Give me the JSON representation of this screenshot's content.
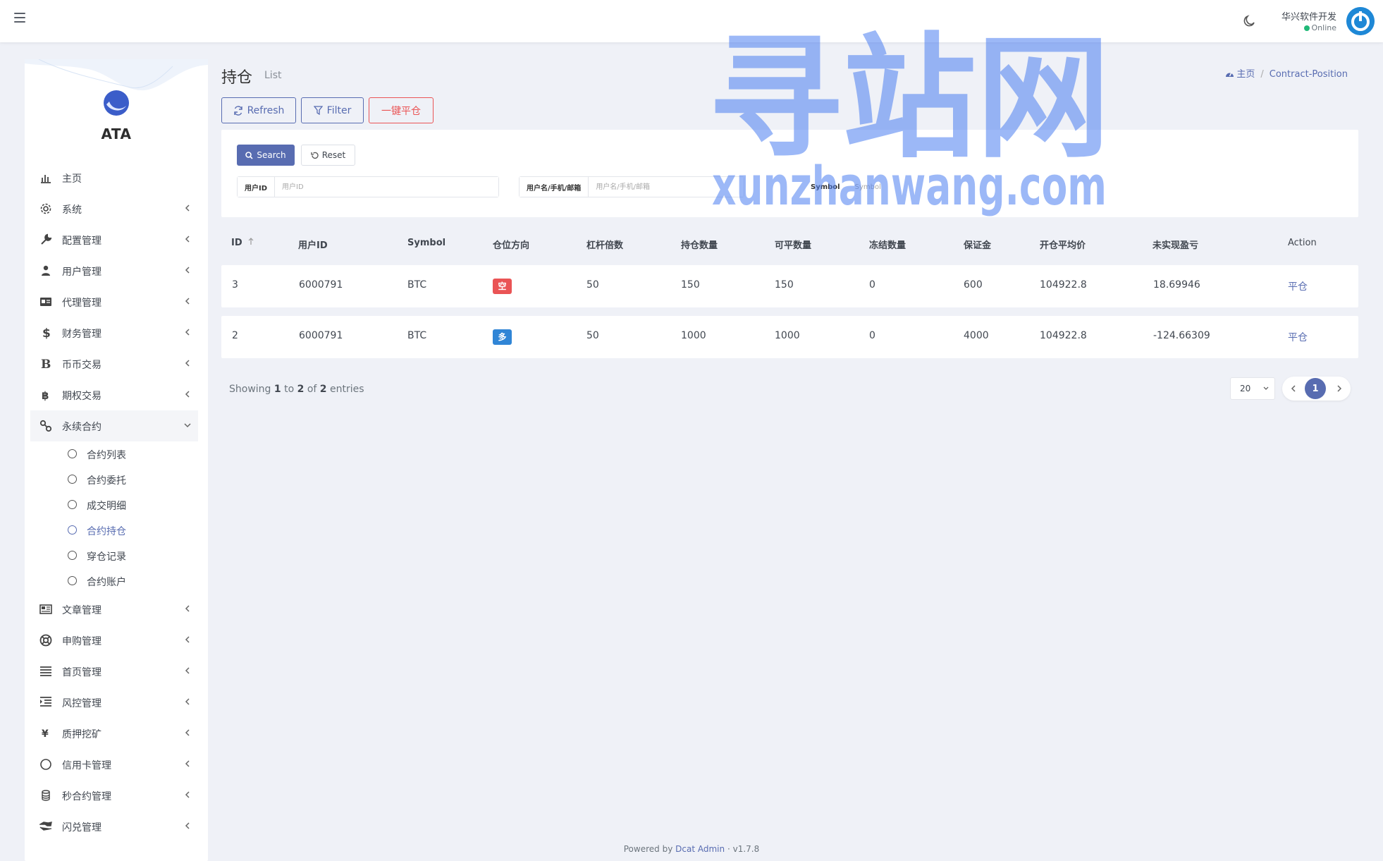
{
  "topbar": {
    "user_name": "华兴软件开发",
    "user_status": "Online"
  },
  "sidebar": {
    "brand": "ATA",
    "menu": [
      {
        "label": "主页",
        "icon": "bar-chart-icon"
      },
      {
        "label": "系统",
        "icon": "gear-icon"
      },
      {
        "label": "配置管理",
        "icon": "wrench-icon"
      },
      {
        "label": "用户管理",
        "icon": "user-tie-icon"
      },
      {
        "label": "代理管理",
        "icon": "id-card-icon"
      },
      {
        "label": "财务管理",
        "icon": "dollar-icon"
      },
      {
        "label": "币币交易",
        "icon": "letter-b-icon"
      },
      {
        "label": "期权交易",
        "icon": "bitcoin-icon"
      },
      {
        "label": "永续合约",
        "icon": "link-icon"
      }
    ],
    "submenu": [
      {
        "label": "合约列表"
      },
      {
        "label": "合约委托"
      },
      {
        "label": "成交明细"
      },
      {
        "label": "合约持仓"
      },
      {
        "label": "穿仓记录"
      },
      {
        "label": "合约账户"
      }
    ],
    "menu_after": [
      {
        "label": "文章管理",
        "icon": "newspaper-icon"
      },
      {
        "label": "申购管理",
        "icon": "lifebuoy-icon"
      },
      {
        "label": "首页管理",
        "icon": "lines-icon"
      },
      {
        "label": "风控管理",
        "icon": "indent-icon"
      },
      {
        "label": "质押挖矿",
        "icon": "yen-icon"
      },
      {
        "label": "信用卡管理",
        "icon": "circle-icon"
      },
      {
        "label": "秒合约管理",
        "icon": "coins-icon"
      },
      {
        "label": "闪兑管理",
        "icon": "exchange-icon"
      }
    ]
  },
  "header": {
    "title": "持仓",
    "subtitle": "List",
    "breadcrumb_home": "主页",
    "breadcrumb_sep": "/",
    "breadcrumb_current": "Contract-Position"
  },
  "toolbar": {
    "refresh_label": "Refresh",
    "filter_label": "Filter",
    "close_all_label": "一键平仓"
  },
  "filter": {
    "search_label": "Search",
    "reset_label": "Reset",
    "fields": [
      {
        "label": "用户ID",
        "placeholder": "用户ID"
      },
      {
        "label": "用户名/手机/邮箱",
        "placeholder": "用户名/手机/邮箱"
      },
      {
        "label": "Symbol",
        "placeholder": "Symbol"
      }
    ]
  },
  "table": {
    "columns": [
      "ID",
      "用户ID",
      "Symbol",
      "仓位方向",
      "杠杆倍数",
      "持仓数量",
      "可平数量",
      "冻结数量",
      "保证金",
      "开仓平均价",
      "未实现盈亏",
      "Action"
    ],
    "rows": [
      {
        "id": "3",
        "user_id": "6000791",
        "symbol": "BTC",
        "direction": "空",
        "direction_color": "#ea5455",
        "leverage": "50",
        "position": "150",
        "closable": "150",
        "frozen": "0",
        "margin": "600",
        "avg_price": "104922.8",
        "pnl": "18.69946",
        "action": "平仓"
      },
      {
        "id": "2",
        "user_id": "6000791",
        "symbol": "BTC",
        "direction": "多",
        "direction_color": "#3085d6",
        "leverage": "50",
        "position": "1000",
        "closable": "1000",
        "frozen": "0",
        "margin": "4000",
        "avg_price": "104922.8",
        "pnl": "-124.66309",
        "action": "平仓"
      }
    ]
  },
  "pagination": {
    "showing_prefix": "Showing",
    "from": "1",
    "to_word": "to",
    "to": "2",
    "of_word": "of",
    "total": "2",
    "entries_word": "entries",
    "per_page": "20",
    "current_page": "1"
  },
  "footer": {
    "powered_by": "Powered by",
    "link": "Dcat Admin",
    "dot": "·",
    "version": "v1.7.8"
  },
  "watermark": {
    "cn": "寻站网",
    "en": "xunzhanwang.com"
  },
  "colors": {
    "primary": "#586cb1",
    "danger": "#ea5455",
    "info": "#3085d6",
    "online": "#21b978",
    "watermark": "#4a7ef0"
  }
}
